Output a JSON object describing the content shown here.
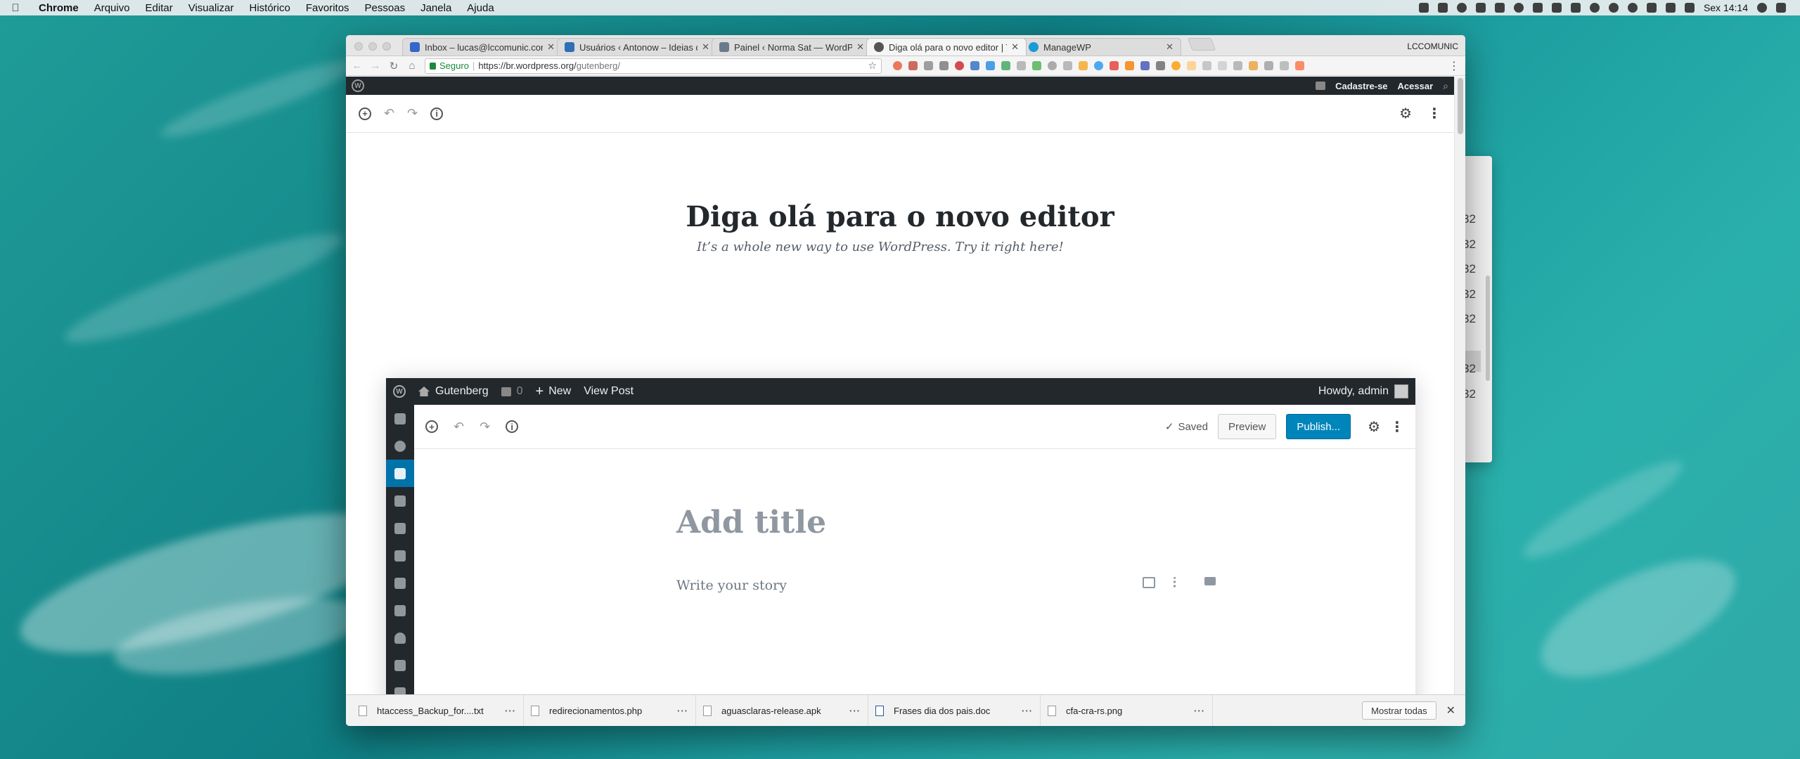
{
  "menubar": {
    "app": "Chrome",
    "items": [
      "Arquivo",
      "Editar",
      "Visualizar",
      "Histórico",
      "Favoritos",
      "Pessoas",
      "Janela",
      "Ajuda"
    ],
    "clock": "Sex 14:14"
  },
  "browser": {
    "profile": "LCCOMUNIC",
    "tabs": [
      {
        "title": "Inbox – lucas@lccomunic.com"
      },
      {
        "title": "Usuários ‹ Antonow – Ideias q"
      },
      {
        "title": "Painel ‹ Norma Sat — WordPre"
      },
      {
        "title": "Diga olá para o novo editor | T"
      },
      {
        "title": "ManageWP"
      }
    ],
    "url_secure_label": "Seguro",
    "url_host": "https://br.wordpress.org/",
    "url_path": "gutenberg/"
  },
  "wp_toolbar": {
    "signup": "Cadastre-se",
    "login": "Acessar"
  },
  "hero": {
    "title": "Diga olá para o novo editor",
    "subtitle": "It’s a whole new way to use WordPress. Try it right here!"
  },
  "demo": {
    "site_name": "Gutenberg",
    "comments_count": "0",
    "new_label": "New",
    "view_post": "View Post",
    "howdy": "Howdy, admin",
    "saved": "Saved",
    "preview": "Preview",
    "publish": "Publish...",
    "title_placeholder": "Add title",
    "body_placeholder": "Write your story"
  },
  "downloads": {
    "items": [
      {
        "name": "htaccess_Backup_for....txt"
      },
      {
        "name": "redirecionamentos.php"
      },
      {
        "name": "aguasclaras-release.apk"
      },
      {
        "name": "Frases dia dos pais.doc"
      },
      {
        "name": "cfa-cra-rs.png"
      }
    ],
    "more_label": "···",
    "show_all": "Mostrar todas"
  },
  "background_window": {
    "values": [
      "32",
      "32",
      "32",
      "32",
      "32",
      "",
      "32",
      "32"
    ]
  }
}
